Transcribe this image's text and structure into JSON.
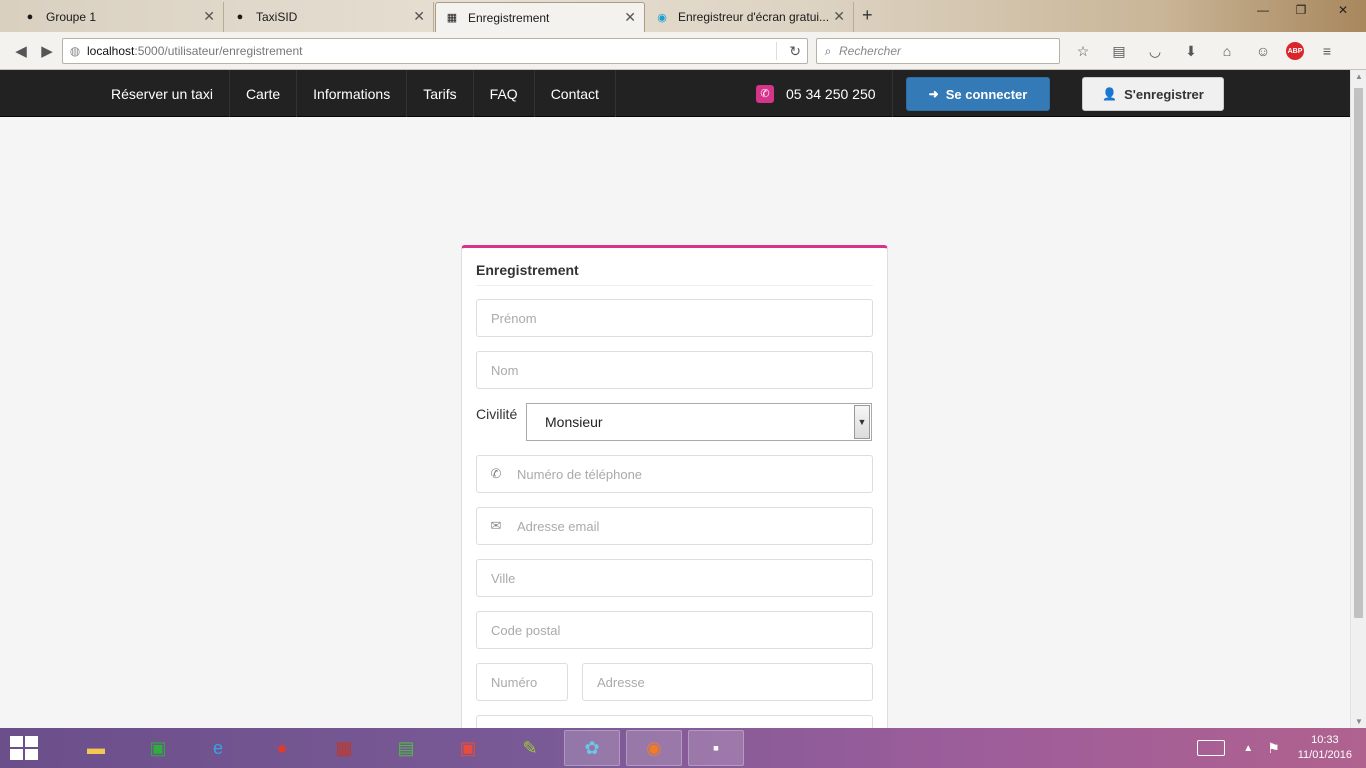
{
  "browser": {
    "tabs": [
      {
        "label": "Groupe 1",
        "icon": "ninja-icon"
      },
      {
        "label": "TaxiSID",
        "icon": "github-icon"
      },
      {
        "label": "Enregistrement",
        "icon": "site-favicon",
        "active": true
      },
      {
        "label": "Enregistreur d'écran gratui...",
        "icon": "camera-icon"
      }
    ],
    "url_host": "localhost",
    "url_path": ":5000/utilisateur/enregistrement",
    "search_placeholder": "Rechercher",
    "abp_label": "ABP"
  },
  "site": {
    "nav": [
      "Réserver un taxi",
      "Carte",
      "Informations",
      "Tarifs",
      "FAQ",
      "Contact"
    ],
    "phone": "05 34 250 250",
    "login_label": "Se connecter",
    "register_label": "S'enregistrer",
    "accent_color": "#d6338a",
    "primary_color": "#337ab7"
  },
  "form": {
    "title": "Enregistrement",
    "firstname_placeholder": "Prénom",
    "lastname_placeholder": "Nom",
    "civility_label": "Civilité",
    "civility_value": "Monsieur",
    "phone_placeholder": "Numéro de téléphone",
    "email_placeholder": "Adresse email",
    "city_placeholder": "Ville",
    "zip_placeholder": "Code postal",
    "number_placeholder": "Numéro",
    "address_placeholder": "Adresse"
  },
  "taskbar": {
    "time": "10:33",
    "date": "11/01/2016"
  }
}
